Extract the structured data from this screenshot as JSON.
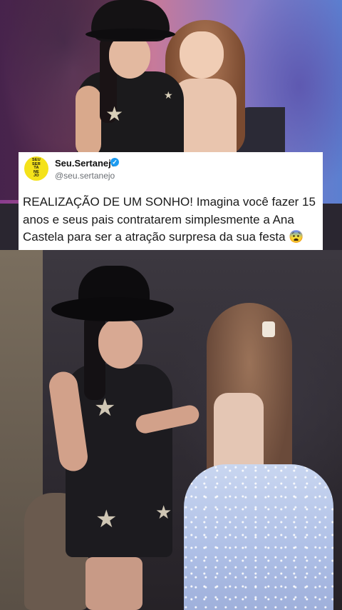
{
  "tweet": {
    "account_name": "Seu.Sertanejo",
    "handle": "@seu.sertanejo",
    "verified": true,
    "avatar_text": [
      "SEU",
      "SER",
      "TA",
      "NE",
      "JO"
    ],
    "avatar_color": "#f4e21a",
    "verified_color": "#1d9bf0",
    "text": "REALIZAÇÃO DE UM SONHO! Imagina você fazer 15 anos e seus pais contratarem simplesmente a Ana Castela para ser a atração surpresa da sua festa 😨"
  },
  "icons": {
    "verified": "verified-badge-icon",
    "star": "star-icon"
  }
}
